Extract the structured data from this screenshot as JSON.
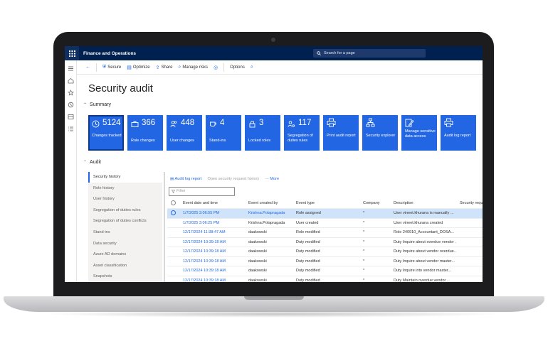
{
  "app": {
    "name": "Finance and Operations",
    "search_placeholder": "Search for a page"
  },
  "toolbar": {
    "secure": "Secure",
    "optimize": "Optimize",
    "share": "Share",
    "manage_risks": "Manage risks",
    "options": "Options"
  },
  "page": {
    "title": "Security audit",
    "summary_label": "Summary",
    "audit_label": "Audit"
  },
  "tiles": [
    {
      "value": "5124",
      "label": "Changes tracked",
      "icon": "clock-icon"
    },
    {
      "value": "366",
      "label": "Role changes",
      "icon": "briefcase-icon"
    },
    {
      "value": "448",
      "label": "User changes",
      "icon": "users-icon"
    },
    {
      "value": "4",
      "label": "Stand-ins",
      "icon": "cup-icon"
    },
    {
      "value": "3",
      "label": "Locked roles",
      "icon": "lock-icon"
    },
    {
      "value": "117",
      "label": "Segregation of duties rules",
      "icon": "person-gear-icon"
    },
    {
      "value": "",
      "label": "Print audit report",
      "icon": "print-icon"
    },
    {
      "value": "",
      "label": "Security explorer",
      "icon": "hierarchy-icon"
    },
    {
      "value": "",
      "label": "Manage sensitive data access",
      "icon": "edit-icon"
    },
    {
      "value": "",
      "label": "Audit log report",
      "icon": "print-icon"
    }
  ],
  "subnav": [
    "Security history",
    "Role history",
    "User history",
    "Segregation of duties rules",
    "Segregation of duties conflicts",
    "Stand-ins",
    "Data security",
    "Azure AD domains",
    "Asset classification",
    "Snapshots"
  ],
  "grid_tools": {
    "audit_log": "Audit log report",
    "open_request": "Open security request history",
    "more": "More",
    "filter_placeholder": "Filter"
  },
  "columns": [
    "Event date and time",
    "Event created by",
    "Event type",
    "Company",
    "Description",
    "Security reque"
  ],
  "rows": [
    {
      "date": "1/7/2025 3:06:55 PM",
      "by": "Krishna.Polapragada",
      "type": "Role assigned",
      "company": "*",
      "desc": "User vineet.khurana is manually ..."
    },
    {
      "date": "1/7/2025 3:06:25 PM",
      "by": "Krishna.Polapragada",
      "type": "User created",
      "company": "*",
      "desc": "User vineet.khurana created"
    },
    {
      "date": "12/17/2024 11:38:47 AM",
      "by": "daakowski",
      "type": "Role modified",
      "company": "*",
      "desc": "Role 240910_Accountant_DOSA..."
    },
    {
      "date": "12/17/2024 10:39:18 AM",
      "by": "daakowski",
      "type": "Duty modified",
      "company": "*",
      "desc": "Duty Inquire about overdue vendor ..."
    },
    {
      "date": "12/17/2024 10:39:18 AM",
      "by": "daakowski",
      "type": "Duty modified",
      "company": "*",
      "desc": "Duty Inquire about vendor overdue..."
    },
    {
      "date": "12/17/2024 10:39:18 AM",
      "by": "daakowski",
      "type": "Duty modified",
      "company": "*",
      "desc": "Duty Inquire about vendor master..."
    },
    {
      "date": "12/17/2024 10:39:18 AM",
      "by": "daakowski",
      "type": "Duty modified",
      "company": "*",
      "desc": "Duty Inquire into vendor master..."
    },
    {
      "date": "12/17/2024 10:39:18 AM",
      "by": "daakowski",
      "type": "Duty modified",
      "company": "*",
      "desc": "Duty Maintain overdue vendor ..."
    }
  ],
  "colors": {
    "accent": "#2266e3",
    "topbar": "#002050",
    "selected_row": "#cfe4fa"
  }
}
